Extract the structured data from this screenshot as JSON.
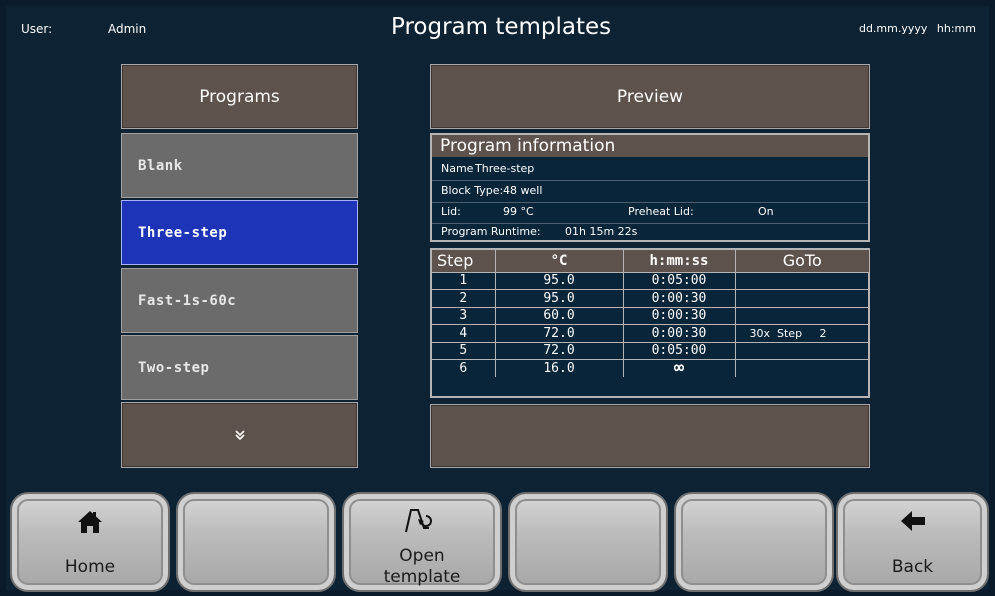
{
  "header": {
    "user_label": "User:",
    "user_value": "Admin",
    "title": "Program templates",
    "date": "dd.mm.yyyy",
    "time": "hh:mm"
  },
  "programs": {
    "header": "Programs",
    "items": [
      "Blank",
      "Three-step",
      "Fast-1s-60c",
      "Two-step"
    ],
    "selected": "Three-step",
    "more_icon": "double-chevron-down-icon"
  },
  "preview": {
    "header": "Preview",
    "info": {
      "title": "Program information",
      "name_label": "Name",
      "name_value": "Three-step",
      "block_type_label": "Block Type:",
      "block_type_value": "48 well",
      "lid_label": "Lid:",
      "lid_value": "99 °C",
      "preheat_label": "Preheat Lid:",
      "preheat_value": "On",
      "runtime_label": "Program Runtime:",
      "runtime_value": "01h 15m 22s"
    },
    "table": {
      "headers": [
        "Step",
        "°C",
        "h:mm:ss",
        "GoTo"
      ],
      "rows": [
        {
          "step": "1",
          "temp": "95.0",
          "time": "0:05:00",
          "goto": ""
        },
        {
          "step": "2",
          "temp": "95.0",
          "time": "0:00:30",
          "goto": ""
        },
        {
          "step": "3",
          "temp": "60.0",
          "time": "0:00:30",
          "goto": ""
        },
        {
          "step": "4",
          "temp": "72.0",
          "time": "0:00:30",
          "goto": "30x  Step     2"
        },
        {
          "step": "5",
          "temp": "72.0",
          "time": "0:05:00",
          "goto": ""
        },
        {
          "step": "6",
          "temp": "16.0",
          "time": "∞",
          "goto": ""
        }
      ]
    }
  },
  "nav": {
    "home_label": "Home",
    "open_label_1": "Open",
    "open_label_2": "template",
    "back_label": "Back",
    "home_icon": "home-icon",
    "open_icon": "open-template-icon",
    "back_icon": "arrow-left-icon"
  },
  "colors": {
    "background": "#0d2233",
    "selected": "#1d34b8",
    "panel_header": "#5e524d"
  }
}
